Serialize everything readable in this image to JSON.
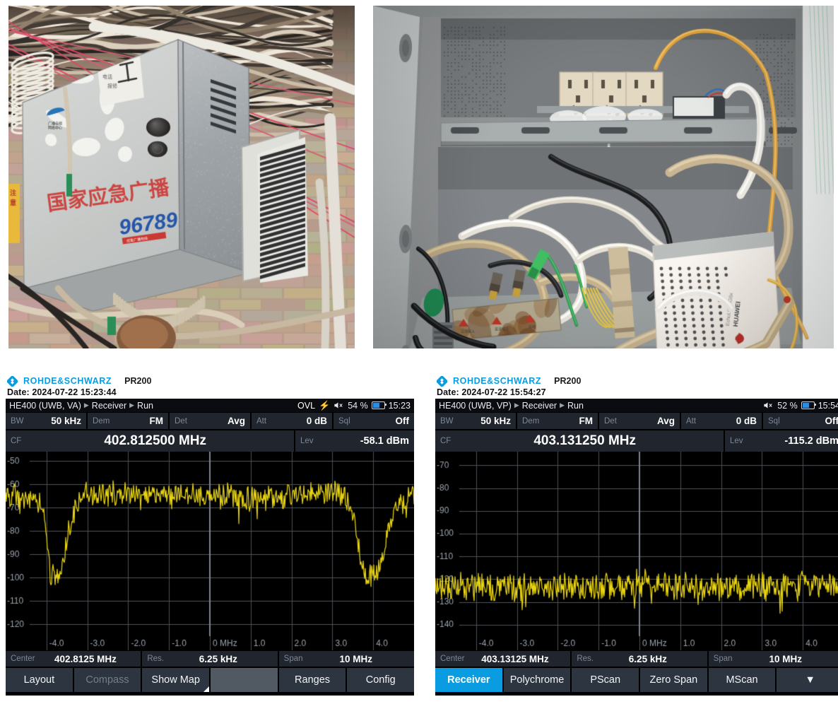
{
  "photos": [
    {
      "name": "street-cabinet-exterior",
      "caption_text_on_cabinet": "国家应急广播",
      "cabinet_number": "96789",
      "scene": "grey metal outdoor broadcast cabinet mounted on a brick wall under a dense tangle of overhead cables"
    },
    {
      "name": "cabinet-interior",
      "device_brand": "HUAWEI",
      "device_model": "EchoLife HG8x",
      "scene": "open cabinet interior with three mains sockets, coiled coax and fibre patch cords, a rusted power controller and a white ONT"
    }
  ],
  "panels": [
    {
      "id": "left",
      "brand": "ROHDE&SCHWARZ",
      "model": "PR200",
      "date_label": "Date: 2024-07-22 15:23:44",
      "breadcrumb": [
        "HE400 (UWB, VA)",
        "Receiver",
        "Run"
      ],
      "status": {
        "ovl": "OVL",
        "bolt_icon": "lightning-bolt-icon",
        "bolt_color": "#ff2020",
        "speaker_icon": "speaker-muted-icon",
        "battery_percent": "54 %",
        "battery_icon": "battery-icon",
        "clock": "15:23"
      },
      "params": [
        {
          "key": "BW",
          "value": "50 kHz"
        },
        {
          "key": "Dem",
          "value": "FM"
        },
        {
          "key": "Det",
          "value": "Avg"
        },
        {
          "key": "Att",
          "value": "0 dB"
        },
        {
          "key": "Sql",
          "value": "Off"
        }
      ],
      "cf": {
        "key": "CF",
        "value": "402.812500 MHz"
      },
      "lev": {
        "key": "Lev",
        "value": "-58.1 dBm"
      },
      "footer": [
        {
          "key": "Center",
          "value": "402.8125 MHz"
        },
        {
          "key": "Res.",
          "value": "6.25 kHz"
        },
        {
          "key": "Span",
          "value": "10 MHz"
        }
      ],
      "softkeys": [
        {
          "label": "Layout",
          "state": "normal"
        },
        {
          "label": "Compass",
          "state": "disabled"
        },
        {
          "label": "Show Map",
          "state": "corner"
        },
        {
          "label": "",
          "state": "blank"
        },
        {
          "label": "Ranges",
          "state": "normal"
        },
        {
          "label": "Config",
          "state": "normal"
        }
      ]
    },
    {
      "id": "right",
      "brand": "ROHDE&SCHWARZ",
      "model": "PR200",
      "date_label": "Date: 2024-07-22 15:54:27",
      "breadcrumb": [
        "HE400 (UWB, VP)",
        "Receiver",
        "Run"
      ],
      "status": {
        "ovl": "",
        "bolt_icon": "",
        "bolt_color": "#ff2020",
        "speaker_icon": "speaker-muted-icon",
        "battery_percent": "52 %",
        "battery_icon": "battery-icon",
        "clock": "15:54"
      },
      "params": [
        {
          "key": "BW",
          "value": "50 kHz"
        },
        {
          "key": "Dem",
          "value": "FM"
        },
        {
          "key": "Det",
          "value": "Avg"
        },
        {
          "key": "Att",
          "value": "0 dB"
        },
        {
          "key": "Sql",
          "value": "Off"
        }
      ],
      "cf": {
        "key": "CF",
        "value": "403.131250 MHz"
      },
      "lev": {
        "key": "Lev",
        "value": "-115.2 dBm"
      },
      "footer": [
        {
          "key": "Center",
          "value": "403.13125 MHz"
        },
        {
          "key": "Res.",
          "value": "6.25 kHz"
        },
        {
          "key": "Span",
          "value": "10 MHz"
        }
      ],
      "softkeys": [
        {
          "label": "Receiver",
          "state": "active"
        },
        {
          "label": "Polychrome",
          "state": "normal"
        },
        {
          "label": "PScan",
          "state": "normal"
        },
        {
          "label": "Zero Span",
          "state": "normal"
        },
        {
          "label": "MScan",
          "state": "normal"
        },
        {
          "label": "▼",
          "state": "caret"
        }
      ]
    }
  ],
  "chart_data": [
    {
      "type": "line",
      "title": "Receiver spectrum — HE400 (UWB, VA), CF 402.812500 MHz",
      "xlabel": "0 MHz",
      "ylabel": "dBm",
      "trace_color": "#e8d411",
      "grid": true,
      "legend": "none",
      "xlim": [
        -5.0,
        5.0
      ],
      "ylim": [
        -125,
        -46
      ],
      "xticks": [
        -4.0,
        -3.0,
        -2.0,
        -1.0,
        0,
        1.0,
        2.0,
        3.0,
        4.0
      ],
      "xticklabels": [
        "-4.0",
        "-3.0",
        "-2.0",
        "-1.0",
        "0 MHz",
        "1.0",
        "2.0",
        "3.0",
        "4.0"
      ],
      "yticks": [
        -50,
        -60,
        -70,
        -80,
        -90,
        -100,
        -110,
        -120
      ],
      "yticklabels": [
        "-50",
        "-60",
        "-70",
        "-80",
        "-90",
        "-100",
        "-110",
        "-120"
      ],
      "marker_x": 0,
      "description": "Broad flat noise plateau near -64 dBm across the span with two deep notches down to about -107 dBm at roughly -3.9 MHz and +3.55 MHz",
      "envelope": [
        {
          "x": -5.0,
          "y": -65
        },
        {
          "x": -4.6,
          "y": -65
        },
        {
          "x": -4.3,
          "y": -67
        },
        {
          "x": -4.1,
          "y": -70
        },
        {
          "x": -4.0,
          "y": -78
        },
        {
          "x": -3.95,
          "y": -92
        },
        {
          "x": -3.9,
          "y": -101
        },
        {
          "x": -3.8,
          "y": -98
        },
        {
          "x": -3.7,
          "y": -99
        },
        {
          "x": -3.6,
          "y": -92
        },
        {
          "x": -3.45,
          "y": -80
        },
        {
          "x": -3.3,
          "y": -70
        },
        {
          "x": -3.1,
          "y": -64
        },
        {
          "x": -2.5,
          "y": -64
        },
        {
          "x": -1.5,
          "y": -64
        },
        {
          "x": -0.5,
          "y": -64
        },
        {
          "x": 0.3,
          "y": -65
        },
        {
          "x": 0.9,
          "y": -67
        },
        {
          "x": 1.4,
          "y": -65
        },
        {
          "x": 2.0,
          "y": -64
        },
        {
          "x": 2.8,
          "y": -63
        },
        {
          "x": 3.2,
          "y": -63
        },
        {
          "x": 3.45,
          "y": -68
        },
        {
          "x": 3.6,
          "y": -80
        },
        {
          "x": 3.7,
          "y": -92
        },
        {
          "x": 3.8,
          "y": -100
        },
        {
          "x": 4.0,
          "y": -99
        },
        {
          "x": 4.15,
          "y": -96
        },
        {
          "x": 4.3,
          "y": -85
        },
        {
          "x": 4.5,
          "y": -72
        },
        {
          "x": 4.7,
          "y": -67
        },
        {
          "x": 5.0,
          "y": -65
        }
      ],
      "noise_db": 5.0
    },
    {
      "type": "line",
      "title": "Receiver spectrum — HE400 (UWB, VP), CF 403.131250 MHz",
      "xlabel": "0 MHz",
      "ylabel": "dBm",
      "trace_color": "#e8d411",
      "grid": true,
      "legend": "none",
      "xlim": [
        -5.0,
        5.0
      ],
      "ylim": [
        -145,
        -64
      ],
      "xticks": [
        -4.0,
        -3.0,
        -2.0,
        -1.0,
        0,
        1.0,
        2.0,
        3.0,
        4.0
      ],
      "xticklabels": [
        "-4.0",
        "-3.0",
        "-2.0",
        "-1.0",
        "0 MHz",
        "1.0",
        "2.0",
        "3.0",
        "4.0"
      ],
      "yticks": [
        -70,
        -80,
        -90,
        -100,
        -110,
        -120,
        -130,
        -140
      ],
      "yticklabels": [
        "-70",
        "-80",
        "-90",
        "-100",
        "-110",
        "-120",
        "-130",
        "-140"
      ],
      "marker_x": 0,
      "description": "Flat receiver noise floor only, averaging about -123 dBm with peaks to -116 dBm and troughs to -132 dBm; no signal present",
      "envelope": [
        {
          "x": -5.0,
          "y": -123
        },
        {
          "x": -4.0,
          "y": -123
        },
        {
          "x": -3.0,
          "y": -123
        },
        {
          "x": -2.0,
          "y": -123
        },
        {
          "x": -1.0,
          "y": -123
        },
        {
          "x": 0.0,
          "y": -122
        },
        {
          "x": 1.0,
          "y": -123
        },
        {
          "x": 2.0,
          "y": -124
        },
        {
          "x": 3.0,
          "y": -123
        },
        {
          "x": 4.0,
          "y": -123
        },
        {
          "x": 5.0,
          "y": -123
        }
      ],
      "noise_db": 6.0
    }
  ]
}
